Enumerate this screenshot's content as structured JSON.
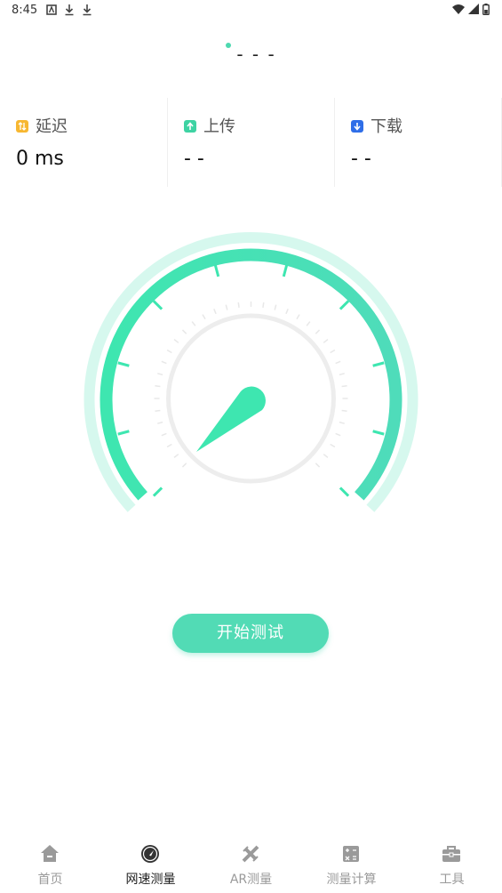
{
  "status_bar": {
    "time": "8:45",
    "left_icons": [
      "a-badge-icon",
      "download-icon",
      "download-icon"
    ],
    "right_icons": [
      "wifi-icon",
      "signal-icon",
      "battery-icon"
    ]
  },
  "server": {
    "label": "- - -"
  },
  "metrics": [
    {
      "label": "延迟",
      "value": "0 ms",
      "icon": "latency-icon",
      "color": "#f7b731"
    },
    {
      "label": "上传",
      "value": "- -",
      "icon": "upload-icon",
      "color": "#3ed3a3"
    },
    {
      "label": "下载",
      "value": "- -",
      "icon": "download-icon",
      "color": "#2f6ee8"
    }
  ],
  "gauge": {
    "accent": "#3ee6b0",
    "accent_light": "#d6f8ee"
  },
  "start_button": {
    "label": "开始测试"
  },
  "tabs": [
    {
      "label": "首页",
      "icon": "home-icon",
      "active": false
    },
    {
      "label": "网速测量",
      "icon": "speedometer-icon",
      "active": true
    },
    {
      "label": "AR测量",
      "icon": "ruler-pencil-icon",
      "active": false
    },
    {
      "label": "测量计算",
      "icon": "calculator-icon",
      "active": false
    },
    {
      "label": "工具",
      "icon": "toolbox-icon",
      "active": false
    }
  ]
}
